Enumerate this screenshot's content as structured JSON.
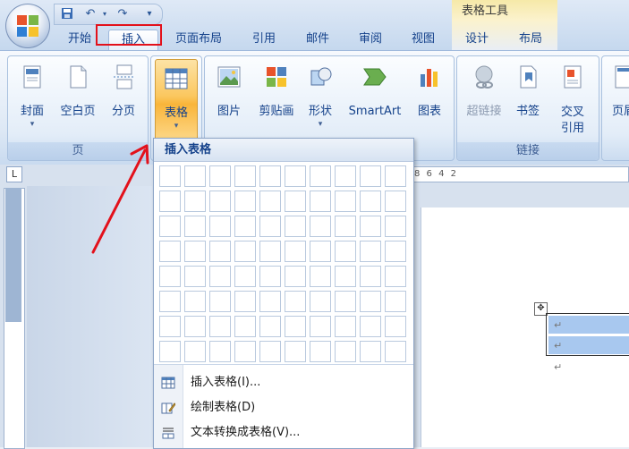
{
  "quick_access": {
    "save_icon": "save-icon",
    "undo_icon": "undo-icon",
    "redo_icon": "redo-icon",
    "customize_icon": "customize-qat-icon"
  },
  "context_group": {
    "title": "表格工具"
  },
  "tabs": [
    {
      "label": "开始"
    },
    {
      "label": "插入"
    },
    {
      "label": "页面布局"
    },
    {
      "label": "引用"
    },
    {
      "label": "邮件"
    },
    {
      "label": "审阅"
    },
    {
      "label": "视图"
    },
    {
      "label": "设计"
    },
    {
      "label": "布局"
    }
  ],
  "ribbon": {
    "pages_group": {
      "label": "页",
      "buttons": [
        {
          "label": "封面",
          "caret": "▾"
        },
        {
          "label": "空白页"
        },
        {
          "label": "分页"
        }
      ]
    },
    "tables_group": {
      "buttons": [
        {
          "label": "表格",
          "caret": "▾"
        }
      ]
    },
    "illustrations_group": {
      "buttons": [
        {
          "label": "图片"
        },
        {
          "label": "剪贴画"
        },
        {
          "label": "形状",
          "caret": "▾"
        },
        {
          "label": "SmartArt"
        },
        {
          "label": "图表"
        }
      ]
    },
    "links_group": {
      "label": "链接",
      "buttons": [
        {
          "label": "超链接"
        },
        {
          "label": "书签"
        },
        {
          "label": "交叉",
          "label2": "引用"
        }
      ]
    },
    "header_group": {
      "buttons": [
        {
          "label": "页眉"
        }
      ]
    }
  },
  "ruler": {
    "text": "8 6 4 2 ",
    "corner_icon": "L"
  },
  "dropdown": {
    "title": "插入表格",
    "grid_cols": 10,
    "grid_rows": 8,
    "items": [
      {
        "label": "插入表格(I)...",
        "icon": "insert-table-icon"
      },
      {
        "label": "绘制表格(D)",
        "icon": "draw-table-icon"
      },
      {
        "label": "文本转换成表格(V)...",
        "icon": "convert-text-table-icon"
      }
    ]
  },
  "document": {
    "paragraph_mark": "↵"
  },
  "colors": {
    "accent": "#15428b",
    "highlight": "#f9b53a",
    "annotation": "#e3111b",
    "table_fill": "#a8c8ef"
  }
}
